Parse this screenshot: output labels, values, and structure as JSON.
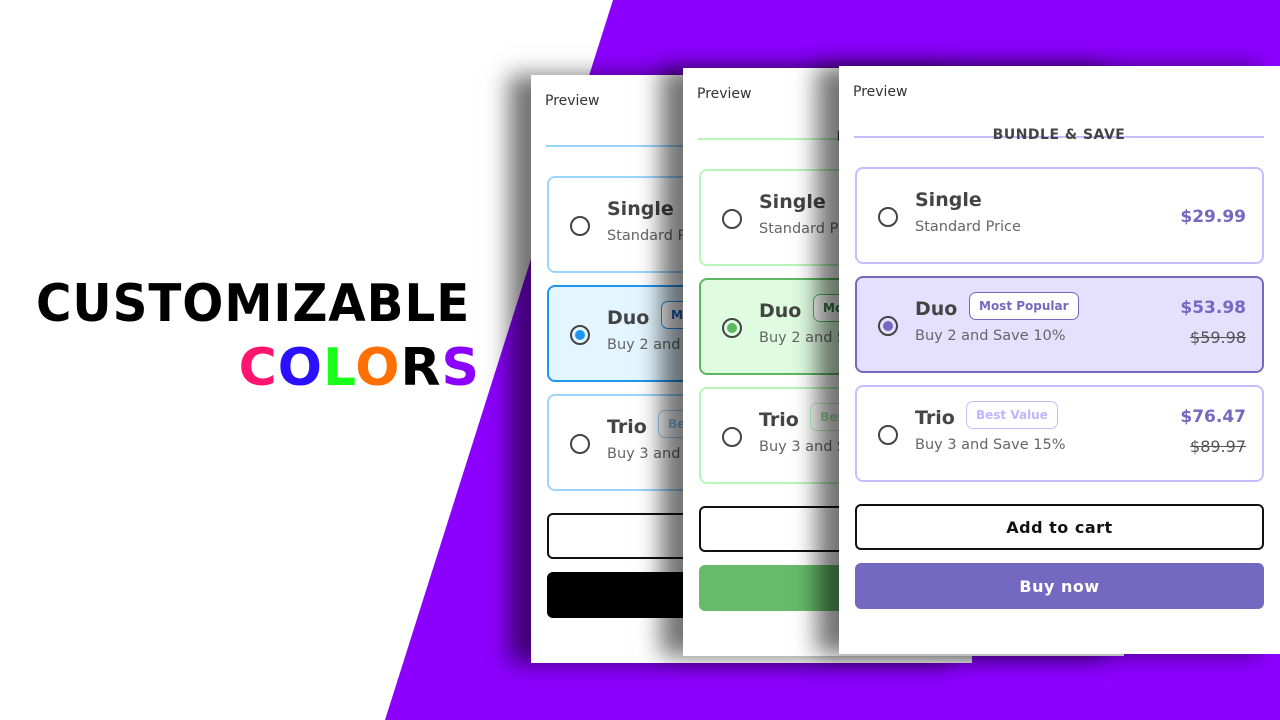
{
  "headline": {
    "line1": "CUSTOMIZABLE",
    "line2_letters": [
      {
        "char": "C",
        "color": "#ff1470"
      },
      {
        "char": "O",
        "color": "#2a10ff"
      },
      {
        "char": "L",
        "color": "#1aff1a"
      },
      {
        "char": "O",
        "color": "#ff7000"
      },
      {
        "char": "R",
        "color": "#000000"
      },
      {
        "char": "S",
        "color": "#8c00ff"
      }
    ]
  },
  "background_color": "#8c00ff",
  "widget": {
    "preview_label": "Preview",
    "section_title": "BUNDLE & SAVE",
    "options": [
      {
        "title": "Single",
        "subtitle": "Standard Price",
        "price": "$29.99",
        "selected": false
      },
      {
        "title": "Duo",
        "badge": "Most Popular",
        "subtitle": "Buy 2 and Save 10%",
        "price": "$53.98",
        "old_price": "$59.98",
        "selected": true
      },
      {
        "title": "Trio",
        "badge": "Best Value",
        "subtitle": "Buy 3 and Save 15%",
        "price": "$76.47",
        "old_price": "$89.97",
        "selected": false
      }
    ],
    "add_to_cart": "Add to cart",
    "buy_now": "Buy now"
  },
  "themes": [
    {
      "name": "blue",
      "accent": "#1e96f0",
      "border": "#9ad6fc",
      "selected_bg": "#e3f5ff",
      "selected_border": "#1e96f0",
      "badge_strong": "#1565c0",
      "badge_light": "#90caf9",
      "buy_bg": "#000000",
      "divider": "#9ad6fc"
    },
    {
      "name": "green",
      "accent": "#5cb860",
      "border": "#b8f5b8",
      "selected_bg": "#e0fce0",
      "selected_border": "#5cb860",
      "badge_strong": "#2e7d32",
      "badge_light": "#a5e6a5",
      "buy_bg": "#66bb6a",
      "divider": "#b8f5b8"
    },
    {
      "name": "purple",
      "accent": "#7469c0",
      "border": "#c8bcff",
      "selected_bg": "#e6e0ff",
      "selected_border": "#7469c0",
      "badge_strong": "#7469c0",
      "badge_light": "#c1b5ff",
      "buy_bg": "#7469c0",
      "divider": "#c8bcff"
    }
  ]
}
